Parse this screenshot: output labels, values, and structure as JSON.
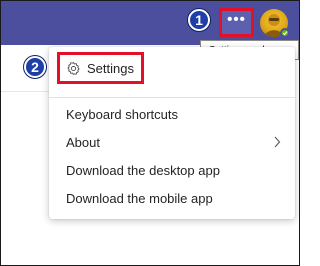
{
  "header": {
    "more_button_label": "•••",
    "tooltip": "Settings and more",
    "accent_color": "#4b4f9e",
    "highlight_color": "#e4102a"
  },
  "annotations": {
    "badge_1": "1",
    "badge_2": "2"
  },
  "menu": {
    "settings_label": "Settings",
    "settings_icon": "gear-icon",
    "items": [
      {
        "label": "Keyboard shortcuts"
      },
      {
        "label": "About",
        "icon": "chevron-right-icon"
      },
      {
        "label": "Download the desktop app"
      },
      {
        "label": "Download the mobile app"
      }
    ]
  }
}
